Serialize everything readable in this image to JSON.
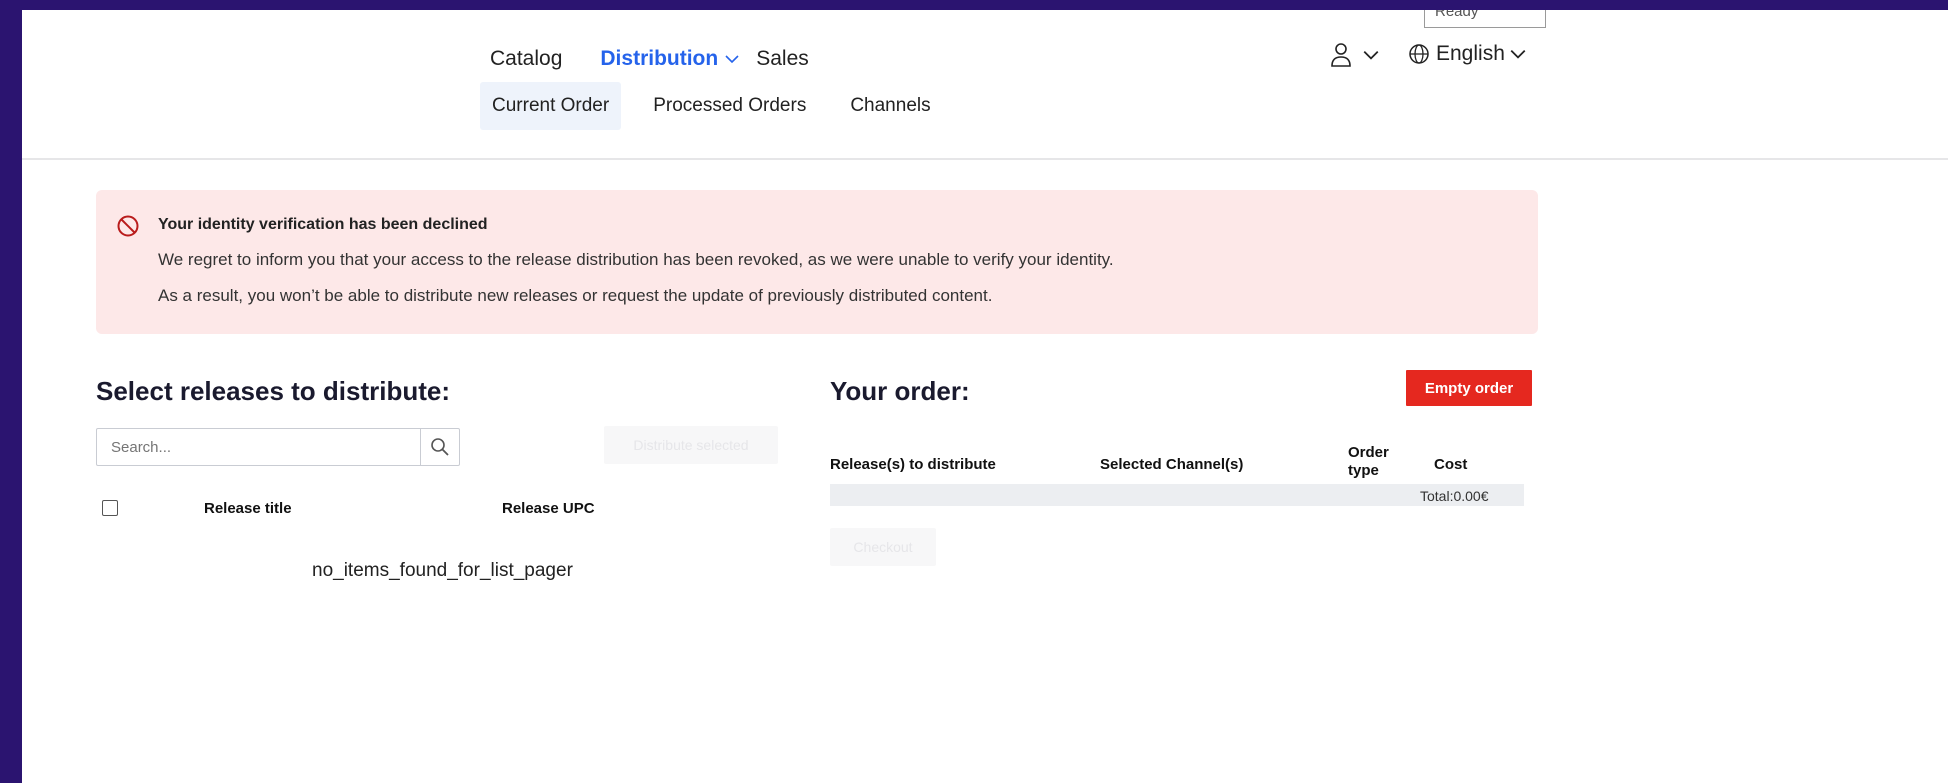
{
  "status_box": "Ready",
  "nav": {
    "top": [
      {
        "label": "Catalog"
      },
      {
        "label": "Distribution"
      },
      {
        "label": "Sales"
      }
    ],
    "sub": [
      {
        "label": "Current Order"
      },
      {
        "label": "Processed Orders"
      },
      {
        "label": "Channels"
      }
    ]
  },
  "language": "English",
  "alert": {
    "title": "Your identity verification has been declined",
    "line1": "We regret to inform you that your access to the release distribution has been revoked, as we were unable to verify your identity.",
    "line2": "As a result, you won’t be able to distribute new releases or request the update of previously distributed content."
  },
  "releases": {
    "heading": "Select releases to distribute:",
    "search_placeholder": "Search...",
    "distribute_label": "Distribute selected",
    "columns": [
      "Release title",
      "Release UPC"
    ],
    "empty_message": "no_items_found_for_list_pager"
  },
  "order": {
    "heading": "Your order:",
    "empty_label": "Empty order",
    "columns": {
      "release": "Release(s) to distribute",
      "channels": "Selected Channel(s)",
      "order_type_1": "Order",
      "order_type_2": "type",
      "cost": "Cost"
    },
    "total": "Total:0.00€",
    "checkout_label": "Checkout"
  },
  "colors": {
    "accent": "#2563eb",
    "alert_bg": "#fde8e8",
    "danger": "#e5281f",
    "backdrop": "#2b1470"
  }
}
